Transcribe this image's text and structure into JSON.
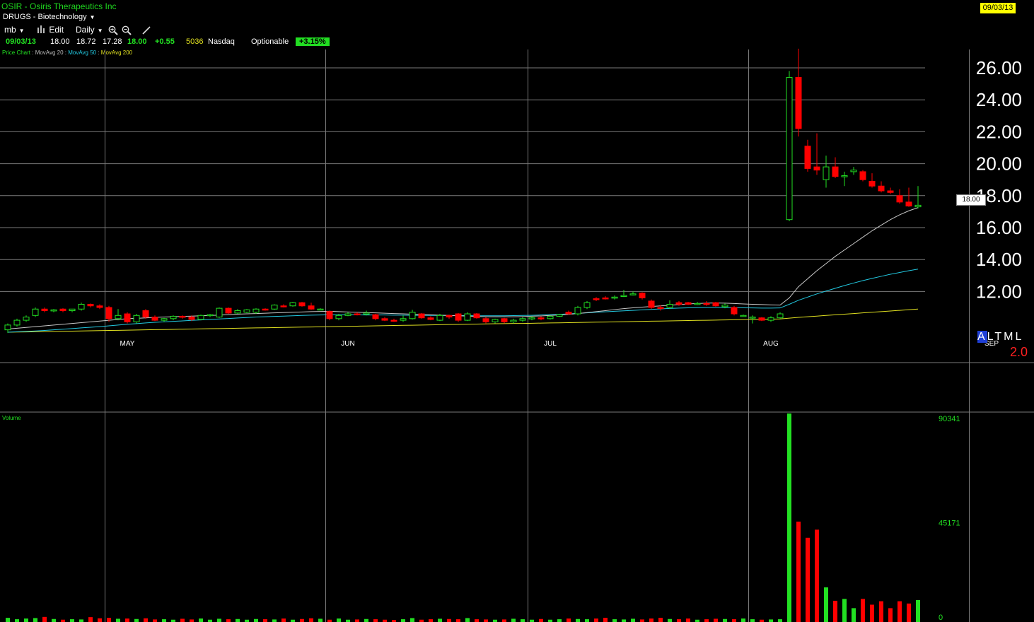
{
  "header": {
    "title": "OSIR - Osiris Therapeutics Inc",
    "sector": "DRUGS - Biotechnology",
    "date_badge": "09/03/13"
  },
  "toolbar": {
    "menu_mb": "mb",
    "edit_label": "Edit",
    "period_label": "Daily"
  },
  "quote": {
    "date": "09/03/13",
    "open": "18.00",
    "high": "18.72",
    "low": "17.28",
    "close": "18.00",
    "change": "+0.55",
    "volume": "5036",
    "exchange": "Nasdaq",
    "optionable": "Optionable",
    "pct_change": "+3.15%"
  },
  "legend": {
    "price_chart": "Price Chart",
    "ma20": "MovAvg 20",
    "ma50": "MovAvg 50",
    "ma200": "MovAvg 200",
    "sep": " : "
  },
  "volume_label": "Volume",
  "price_tag": "18.00",
  "altml": {
    "letters": [
      "A",
      "L",
      "T",
      "M",
      "L"
    ],
    "value": "2.0"
  },
  "colors": {
    "up": "#22e022",
    "down": "#ff0000",
    "ma20": "#c8c8c8",
    "ma50": "#22c8e0",
    "ma200": "#e0e020",
    "grid": "#7a7a7a"
  },
  "chart_data": [
    {
      "type": "candlestick",
      "y_ticks": [
        "12.00",
        "14.00",
        "16.00",
        "18.00",
        "20.00",
        "22.00",
        "26.00",
        "24.00"
      ],
      "y_tick_values": [
        12,
        14,
        16,
        18,
        20,
        22,
        26,
        24
      ],
      "ylim": [
        9.25,
        27.6
      ],
      "month_labels": [
        "MAY",
        "JUN",
        "JUL",
        "AUG",
        "SEP"
      ],
      "month_bar_index": [
        11,
        35,
        57,
        81,
        105
      ],
      "candles": [
        {
          "o": 9.6,
          "h": 10.0,
          "l": 9.4,
          "c": 9.9
        },
        {
          "o": 9.9,
          "h": 10.3,
          "l": 9.8,
          "c": 10.2
        },
        {
          "o": 10.2,
          "h": 10.5,
          "l": 10.1,
          "c": 10.4
        },
        {
          "o": 10.5,
          "h": 11.0,
          "l": 10.4,
          "c": 10.9
        },
        {
          "o": 10.9,
          "h": 11.0,
          "l": 10.7,
          "c": 10.8
        },
        {
          "o": 10.8,
          "h": 10.9,
          "l": 10.7,
          "c": 10.85
        },
        {
          "o": 10.9,
          "h": 10.95,
          "l": 10.7,
          "c": 10.8
        },
        {
          "o": 10.8,
          "h": 10.9,
          "l": 10.7,
          "c": 10.9
        },
        {
          "o": 10.9,
          "h": 11.3,
          "l": 10.8,
          "c": 11.2
        },
        {
          "o": 11.2,
          "h": 11.25,
          "l": 11.0,
          "c": 11.1
        },
        {
          "o": 11.1,
          "h": 11.2,
          "l": 10.9,
          "c": 11.0
        },
        {
          "o": 11.0,
          "h": 11.1,
          "l": 10.1,
          "c": 10.3
        },
        {
          "o": 10.3,
          "h": 10.9,
          "l": 10.2,
          "c": 10.5
        },
        {
          "o": 10.6,
          "h": 10.7,
          "l": 10.0,
          "c": 10.1
        },
        {
          "o": 10.1,
          "h": 10.6,
          "l": 10.0,
          "c": 10.5
        },
        {
          "o": 10.8,
          "h": 10.9,
          "l": 10.3,
          "c": 10.4
        },
        {
          "o": 10.4,
          "h": 10.5,
          "l": 10.15,
          "c": 10.2
        },
        {
          "o": 10.2,
          "h": 10.35,
          "l": 10.1,
          "c": 10.3
        },
        {
          "o": 10.3,
          "h": 10.5,
          "l": 10.2,
          "c": 10.45
        },
        {
          "o": 10.45,
          "h": 10.5,
          "l": 10.3,
          "c": 10.4
        },
        {
          "o": 10.4,
          "h": 10.5,
          "l": 10.15,
          "c": 10.25
        },
        {
          "o": 10.25,
          "h": 10.55,
          "l": 10.2,
          "c": 10.5
        },
        {
          "o": 10.5,
          "h": 10.6,
          "l": 10.4,
          "c": 10.55
        },
        {
          "o": 10.4,
          "h": 11.0,
          "l": 10.35,
          "c": 10.95
        },
        {
          "o": 10.95,
          "h": 11.0,
          "l": 10.6,
          "c": 10.65
        },
        {
          "o": 10.65,
          "h": 10.9,
          "l": 10.6,
          "c": 10.8
        },
        {
          "o": 10.7,
          "h": 10.9,
          "l": 10.65,
          "c": 10.85
        },
        {
          "o": 10.7,
          "h": 10.95,
          "l": 10.6,
          "c": 10.9
        },
        {
          "o": 10.9,
          "h": 10.95,
          "l": 10.8,
          "c": 10.85
        },
        {
          "o": 10.9,
          "h": 11.2,
          "l": 10.85,
          "c": 11.15
        },
        {
          "o": 11.1,
          "h": 11.2,
          "l": 11.0,
          "c": 11.05
        },
        {
          "o": 11.1,
          "h": 11.35,
          "l": 11.05,
          "c": 11.3
        },
        {
          "o": 11.3,
          "h": 11.35,
          "l": 11.05,
          "c": 11.1
        },
        {
          "o": 11.1,
          "h": 11.3,
          "l": 10.85,
          "c": 10.9
        },
        {
          "o": 10.9,
          "h": 10.95,
          "l": 10.85,
          "c": 10.9
        },
        {
          "o": 10.75,
          "h": 10.8,
          "l": 10.2,
          "c": 10.3
        },
        {
          "o": 10.3,
          "h": 10.6,
          "l": 10.2,
          "c": 10.5
        },
        {
          "o": 10.5,
          "h": 10.7,
          "l": 10.45,
          "c": 10.6
        },
        {
          "o": 10.6,
          "h": 10.7,
          "l": 10.5,
          "c": 10.55
        },
        {
          "o": 10.6,
          "h": 10.8,
          "l": 10.5,
          "c": 10.65
        },
        {
          "o": 10.55,
          "h": 10.6,
          "l": 10.2,
          "c": 10.3
        },
        {
          "o": 10.3,
          "h": 10.4,
          "l": 10.15,
          "c": 10.2
        },
        {
          "o": 10.2,
          "h": 10.3,
          "l": 10.1,
          "c": 10.15
        },
        {
          "o": 10.2,
          "h": 10.5,
          "l": 10.1,
          "c": 10.3
        },
        {
          "o": 10.3,
          "h": 10.85,
          "l": 10.25,
          "c": 10.7
        },
        {
          "o": 10.6,
          "h": 10.65,
          "l": 10.3,
          "c": 10.35
        },
        {
          "o": 10.35,
          "h": 10.45,
          "l": 10.2,
          "c": 10.25
        },
        {
          "o": 10.2,
          "h": 10.6,
          "l": 10.15,
          "c": 10.5
        },
        {
          "o": 10.5,
          "h": 10.55,
          "l": 10.3,
          "c": 10.4
        },
        {
          "o": 10.6,
          "h": 10.65,
          "l": 10.1,
          "c": 10.2
        },
        {
          "o": 10.2,
          "h": 10.7,
          "l": 10.15,
          "c": 10.6
        },
        {
          "o": 10.6,
          "h": 10.65,
          "l": 10.3,
          "c": 10.35
        },
        {
          "o": 10.3,
          "h": 10.4,
          "l": 10.0,
          "c": 10.1
        },
        {
          "o": 10.1,
          "h": 10.3,
          "l": 10.0,
          "c": 10.25
        },
        {
          "o": 10.3,
          "h": 10.35,
          "l": 10.0,
          "c": 10.1
        },
        {
          "o": 10.1,
          "h": 10.3,
          "l": 10.0,
          "c": 10.2
        },
        {
          "o": 10.2,
          "h": 10.4,
          "l": 10.1,
          "c": 10.3
        },
        {
          "o": 10.3,
          "h": 10.45,
          "l": 10.2,
          "c": 10.35
        },
        {
          "o": 10.35,
          "h": 10.45,
          "l": 10.2,
          "c": 10.3
        },
        {
          "o": 10.3,
          "h": 10.5,
          "l": 10.25,
          "c": 10.45
        },
        {
          "o": 10.45,
          "h": 10.6,
          "l": 10.4,
          "c": 10.55
        },
        {
          "o": 10.7,
          "h": 10.8,
          "l": 10.55,
          "c": 10.6
        },
        {
          "o": 10.6,
          "h": 11.1,
          "l": 10.5,
          "c": 11.0
        },
        {
          "o": 11.0,
          "h": 11.4,
          "l": 10.9,
          "c": 11.3
        },
        {
          "o": 11.55,
          "h": 11.65,
          "l": 11.4,
          "c": 11.5
        },
        {
          "o": 11.6,
          "h": 11.7,
          "l": 11.5,
          "c": 11.55
        },
        {
          "o": 11.6,
          "h": 11.75,
          "l": 11.5,
          "c": 11.65
        },
        {
          "o": 11.7,
          "h": 12.1,
          "l": 11.65,
          "c": 11.75
        },
        {
          "o": 11.8,
          "h": 12.0,
          "l": 11.75,
          "c": 11.85
        },
        {
          "o": 11.9,
          "h": 11.95,
          "l": 11.5,
          "c": 11.6
        },
        {
          "o": 11.4,
          "h": 11.5,
          "l": 10.9,
          "c": 11.0
        },
        {
          "o": 11.0,
          "h": 11.15,
          "l": 10.8,
          "c": 10.95
        },
        {
          "o": 11.0,
          "h": 11.45,
          "l": 10.9,
          "c": 11.2
        },
        {
          "o": 11.3,
          "h": 11.4,
          "l": 11.1,
          "c": 11.2
        },
        {
          "o": 11.3,
          "h": 11.35,
          "l": 11.15,
          "c": 11.2
        },
        {
          "o": 11.25,
          "h": 11.35,
          "l": 11.15,
          "c": 11.25
        },
        {
          "o": 11.25,
          "h": 11.4,
          "l": 11.1,
          "c": 11.2
        },
        {
          "o": 11.3,
          "h": 11.35,
          "l": 11.05,
          "c": 11.1
        },
        {
          "o": 11.05,
          "h": 11.25,
          "l": 10.95,
          "c": 11.15
        },
        {
          "o": 11.0,
          "h": 11.1,
          "l": 10.5,
          "c": 10.6
        },
        {
          "o": 10.5,
          "h": 10.55,
          "l": 10.45,
          "c": 10.5
        },
        {
          "o": 10.4,
          "h": 10.5,
          "l": 10.0,
          "c": 10.4
        },
        {
          "o": 10.35,
          "h": 10.4,
          "l": 10.15,
          "c": 10.2
        },
        {
          "o": 10.2,
          "h": 10.45,
          "l": 10.1,
          "c": 10.35
        },
        {
          "o": 10.35,
          "h": 10.7,
          "l": 10.3,
          "c": 10.6
        },
        {
          "o": 16.5,
          "h": 25.8,
          "l": 16.4,
          "c": 25.4
        },
        {
          "o": 25.4,
          "h": 27.2,
          "l": 21.7,
          "c": 22.2
        },
        {
          "o": 21.1,
          "h": 21.5,
          "l": 19.5,
          "c": 19.7
        },
        {
          "o": 19.8,
          "h": 21.9,
          "l": 19.3,
          "c": 19.6
        },
        {
          "o": 19.0,
          "h": 20.5,
          "l": 18.5,
          "c": 19.8
        },
        {
          "o": 19.8,
          "h": 20.4,
          "l": 19.1,
          "c": 19.2
        },
        {
          "o": 19.2,
          "h": 19.5,
          "l": 18.6,
          "c": 19.25
        },
        {
          "o": 19.5,
          "h": 19.8,
          "l": 19.3,
          "c": 19.6
        },
        {
          "o": 19.5,
          "h": 19.6,
          "l": 18.9,
          "c": 19.0
        },
        {
          "o": 18.9,
          "h": 19.4,
          "l": 18.5,
          "c": 18.6
        },
        {
          "o": 18.6,
          "h": 18.9,
          "l": 18.2,
          "c": 18.3
        },
        {
          "o": 18.3,
          "h": 18.5,
          "l": 18.1,
          "c": 18.2
        },
        {
          "o": 18.0,
          "h": 18.4,
          "l": 17.5,
          "c": 17.6
        },
        {
          "o": 17.6,
          "h": 18.5,
          "l": 17.3,
          "c": 17.35
        },
        {
          "o": 17.3,
          "h": 18.6,
          "l": 17.2,
          "c": 17.4
        }
      ],
      "ma20": [
        9.65,
        9.7,
        9.75,
        9.8,
        9.85,
        9.9,
        9.95,
        10.0,
        10.05,
        10.1,
        10.15,
        10.2,
        10.25,
        10.3,
        10.32,
        10.35,
        10.38,
        10.4,
        10.42,
        10.44,
        10.46,
        10.48,
        10.5,
        10.52,
        10.55,
        10.58,
        10.6,
        10.62,
        10.64,
        10.66,
        10.68,
        10.7,
        10.72,
        10.74,
        10.75,
        10.76,
        10.74,
        10.72,
        10.7,
        10.68,
        10.66,
        10.64,
        10.62,
        10.6,
        10.58,
        10.56,
        10.54,
        10.52,
        10.5,
        10.48,
        10.46,
        10.44,
        10.42,
        10.42,
        10.42,
        10.42,
        10.43,
        10.45,
        10.47,
        10.5,
        10.53,
        10.57,
        10.62,
        10.68,
        10.74,
        10.8,
        10.87,
        10.93,
        10.98,
        11.02,
        11.06,
        11.1,
        11.14,
        11.18,
        11.22,
        11.25,
        11.27,
        11.28,
        11.27,
        11.25,
        11.22,
        11.2,
        11.18,
        11.16,
        11.15,
        11.6,
        12.3,
        12.8,
        13.3,
        13.75,
        14.2,
        14.6,
        15.0,
        15.4,
        15.8,
        16.15,
        16.5,
        16.8,
        17.05,
        17.25
      ],
      "ma50": [
        9.45,
        9.48,
        9.5,
        9.53,
        9.56,
        9.6,
        9.64,
        9.68,
        9.72,
        9.76,
        9.8,
        9.85,
        9.9,
        9.95,
        9.99,
        10.03,
        10.07,
        10.1,
        10.13,
        10.16,
        10.19,
        10.22,
        10.25,
        10.28,
        10.31,
        10.34,
        10.37,
        10.4,
        10.42,
        10.44,
        10.46,
        10.48,
        10.5,
        10.52,
        10.53,
        10.54,
        10.54,
        10.54,
        10.54,
        10.53,
        10.53,
        10.53,
        10.52,
        10.52,
        10.51,
        10.51,
        10.5,
        10.5,
        10.49,
        10.49,
        10.49,
        10.48,
        10.48,
        10.48,
        10.48,
        10.49,
        10.5,
        10.51,
        10.53,
        10.55,
        10.57,
        10.6,
        10.63,
        10.66,
        10.7,
        10.73,
        10.76,
        10.79,
        10.82,
        10.85,
        10.88,
        10.91,
        10.94,
        10.96,
        10.98,
        10.99,
        11.0,
        11.0,
        11.0,
        10.99,
        10.98,
        10.97,
        10.96,
        10.96,
        10.97,
        11.2,
        11.45,
        11.65,
        11.85,
        12.03,
        12.2,
        12.37,
        12.53,
        12.68,
        12.82,
        12.95,
        13.08,
        13.19,
        13.3,
        13.4
      ],
      "ma200": [
        9.45,
        9.46,
        9.47,
        9.48,
        9.49,
        9.5,
        9.51,
        9.52,
        9.53,
        9.54,
        9.55,
        9.56,
        9.57,
        9.58,
        9.59,
        9.6,
        9.61,
        9.62,
        9.63,
        9.64,
        9.65,
        9.66,
        9.67,
        9.68,
        9.69,
        9.7,
        9.71,
        9.72,
        9.73,
        9.74,
        9.75,
        9.76,
        9.77,
        9.78,
        9.79,
        9.8,
        9.81,
        9.82,
        9.83,
        9.84,
        9.85,
        9.86,
        9.87,
        9.88,
        9.89,
        9.9,
        9.91,
        9.92,
        9.93,
        9.94,
        9.95,
        9.96,
        9.97,
        9.98,
        9.99,
        10.0,
        10.0,
        10.01,
        10.02,
        10.03,
        10.04,
        10.05,
        10.06,
        10.07,
        10.08,
        10.09,
        10.1,
        10.11,
        10.12,
        10.13,
        10.14,
        10.15,
        10.16,
        10.17,
        10.18,
        10.19,
        10.2,
        10.21,
        10.22,
        10.23,
        10.24,
        10.25,
        10.26,
        10.27,
        10.28,
        10.33,
        10.38,
        10.42,
        10.46,
        10.5,
        10.54,
        10.58,
        10.62,
        10.66,
        10.7,
        10.74,
        10.78,
        10.82,
        10.86,
        10.9
      ]
    },
    {
      "type": "bar",
      "title": "Volume",
      "y_ticks": [
        "90341",
        "45171",
        "0"
      ],
      "y_tick_values": [
        90341,
        45171,
        0
      ],
      "ylim": [
        0,
        90341
      ],
      "volumes": [
        1800,
        1200,
        1500,
        1700,
        2200,
        1300,
        1000,
        1200,
        1100,
        2100,
        1600,
        1800,
        1400,
        1500,
        1300,
        1600,
        1100,
        1200,
        1000,
        1400,
        1100,
        1500,
        1000,
        1400,
        1200,
        1300,
        1000,
        1300,
        1200,
        1100,
        1500,
        1000,
        1300,
        1600,
        1400,
        1000,
        1500,
        1000,
        1100,
        1300,
        1200,
        1000,
        900,
        1200,
        1700,
        1000,
        1200,
        1400,
        1300,
        1200,
        1700,
        1200,
        1100,
        1000,
        1100,
        1400,
        1200,
        1000,
        1300,
        1000,
        1200,
        1500,
        1300,
        1200,
        1500,
        1800,
        1200,
        1100,
        1400,
        1100,
        1500,
        1800,
        1300,
        1200,
        1500,
        1000,
        1200,
        1400,
        1300,
        1200,
        1500,
        1200,
        1000,
        1100,
        1200,
        90341,
        43500,
        36500,
        40000,
        15000,
        9200,
        10000,
        6000,
        10000,
        7500,
        9000,
        6000,
        9000,
        8000,
        9500
      ]
    }
  ]
}
